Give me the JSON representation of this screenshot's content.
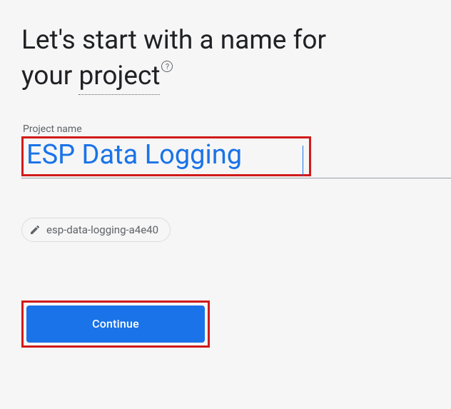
{
  "heading": {
    "line1": "Let's start with a name for",
    "line2_prefix": "your ",
    "project_word": "project",
    "help_symbol": "?"
  },
  "field": {
    "label": "Project name",
    "value": "ESP Data Logging"
  },
  "chip": {
    "id_text": "esp-data-logging-a4e40"
  },
  "actions": {
    "continue_label": "Continue"
  }
}
